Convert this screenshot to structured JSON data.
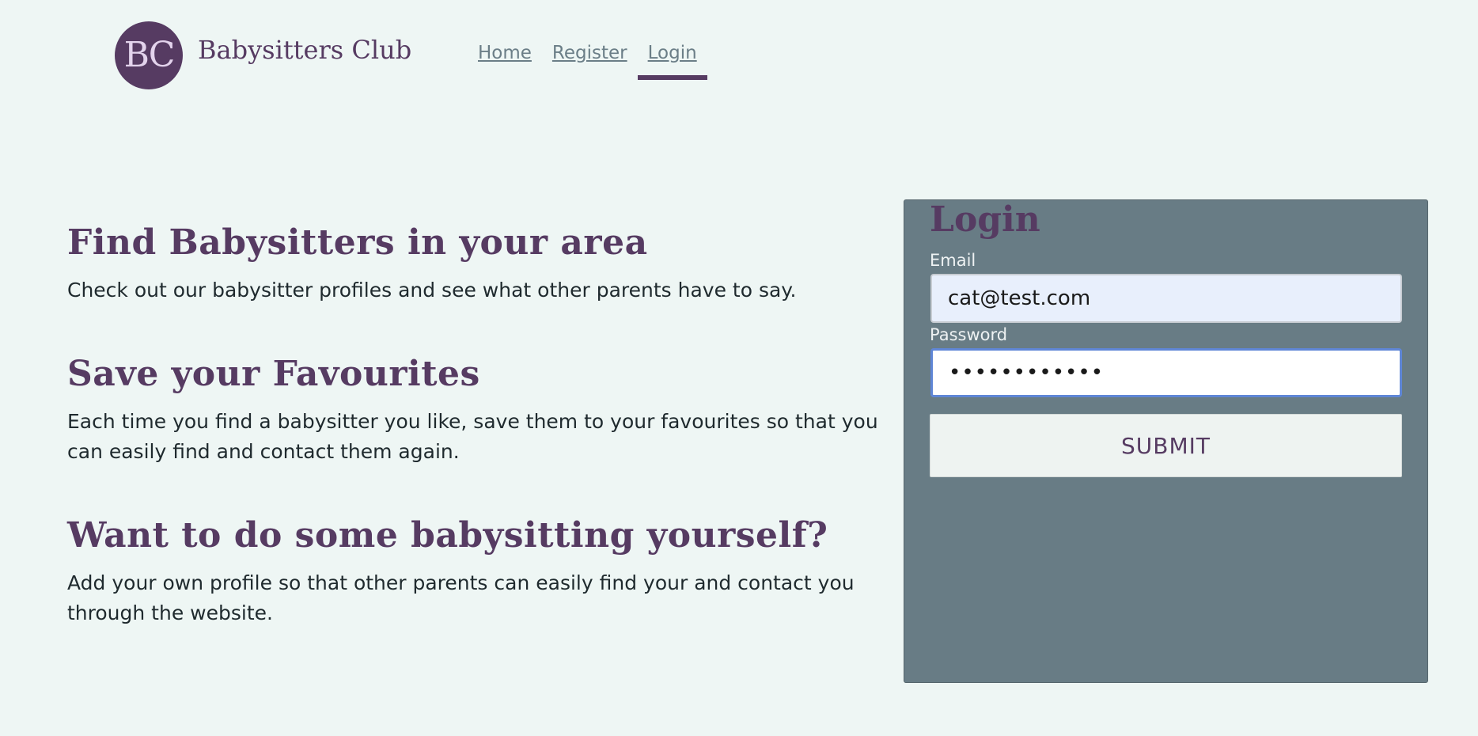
{
  "brand": {
    "logo_initials": "BC",
    "name": "Babysitters Club",
    "color": "#563b62"
  },
  "nav": {
    "items": [
      {
        "label": "Home"
      },
      {
        "label": "Register"
      },
      {
        "label": "Login",
        "active": true
      }
    ]
  },
  "features": [
    {
      "title": "Find Babysitters in your area",
      "text": "Check out our babysitter profiles and see what other parents have to say."
    },
    {
      "title": "Save your Favourites",
      "text": "Each time you find a babysitter you like, save them to your favourites so that you can easily find and contact them again."
    },
    {
      "title": "Want to do some babysitting yourself?",
      "text": "Add your own profile so that other parents can easily find your and contact you through the website."
    }
  ],
  "login": {
    "title": "Login",
    "email_label": "Email",
    "email_value": "cat@test.com",
    "password_label": "Password",
    "password_value": "••••••••••••",
    "submit_label": "SUBMIT",
    "panel_color": "#687c85"
  }
}
